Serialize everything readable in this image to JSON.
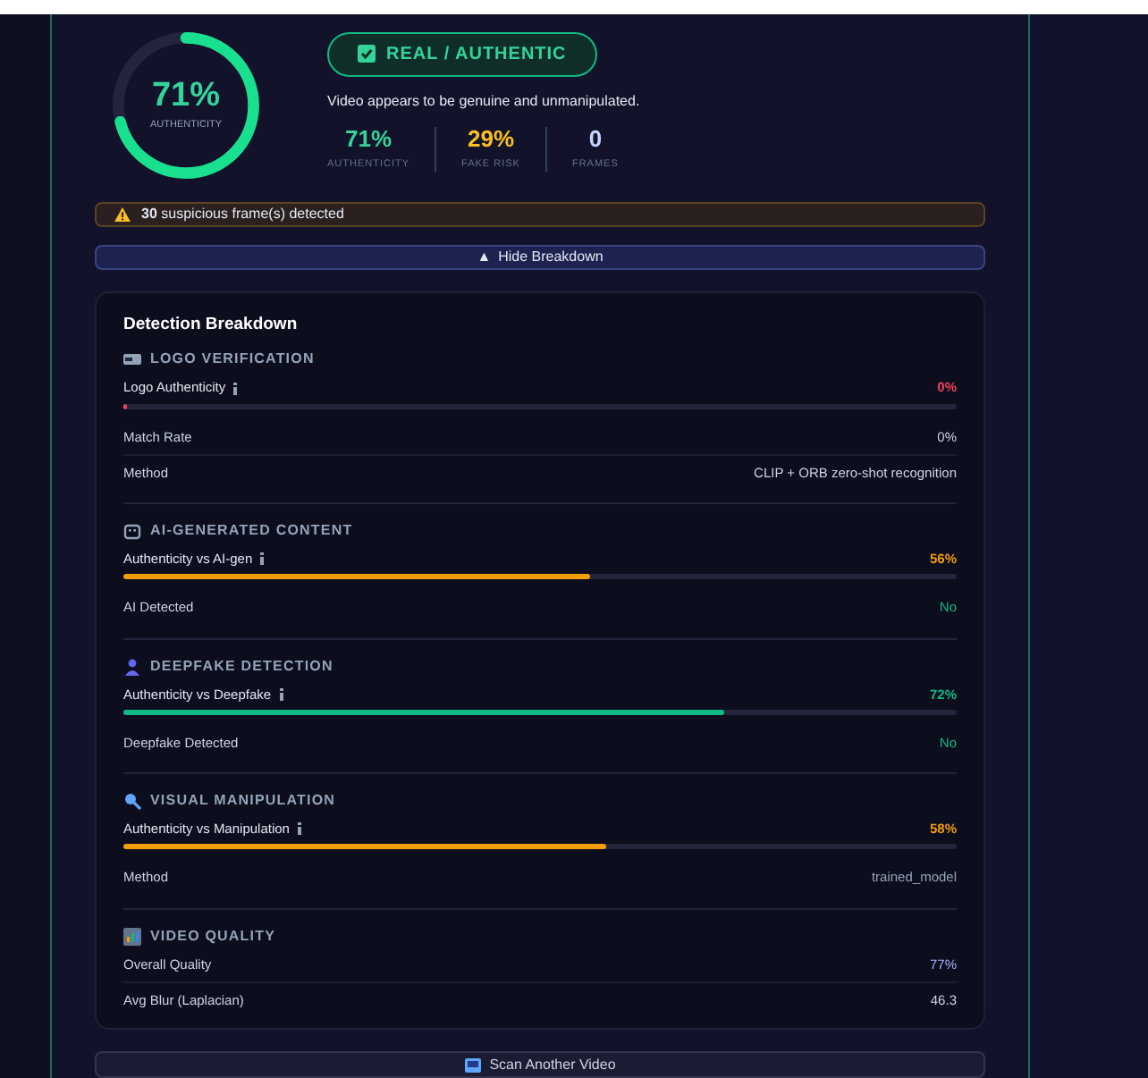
{
  "score": {
    "value": "71%",
    "label": "AUTHENTICITY"
  },
  "verdict": {
    "label": "REAL / AUTHENTIC",
    "kind": "real",
    "description": "Video appears to be genuine and unmanipulated."
  },
  "stats": [
    {
      "value": "71%",
      "label": "AUTHENTICITY",
      "color": "#34d399"
    },
    {
      "value": "29%",
      "label": "FAKE RISK",
      "color": "#fbbf24"
    },
    {
      "value": "0",
      "label": "FRAMES",
      "color": "#c7d2fe"
    }
  ],
  "warning": {
    "count": "30",
    "text": "suspicious frame(s) detected"
  },
  "toggle": {
    "arrow": "▲",
    "label": "Hide Breakdown",
    "expanded": true
  },
  "breakdown": {
    "title": "Detection Breakdown",
    "sections": [
      {
        "kind": "logo",
        "title": "LOGO VERIFICATION",
        "rows": [
          {
            "kind": "bar",
            "label": "Logo Authenticity",
            "value": "0%",
            "level": 0,
            "color": "#f43f5e"
          },
          {
            "kind": "row",
            "label": "Match Rate",
            "value": "0%",
            "color": "#cbd5e1"
          },
          {
            "kind": "row",
            "label": "Method",
            "value": "CLIP + ORB zero-shot recognition",
            "color": "#cbd5e1"
          }
        ]
      },
      {
        "kind": "ai",
        "title": "AI-GENERATED CONTENT",
        "rows": [
          {
            "kind": "bar",
            "label": "Authenticity vs AI-gen",
            "value": "56%",
            "level": 0.56,
            "color": "#f59e0b"
          },
          {
            "kind": "row",
            "label": "AI Detected",
            "value": "No",
            "color": "#10b981"
          }
        ]
      },
      {
        "kind": "deepfake",
        "title": "DEEPFAKE DETECTION",
        "rows": [
          {
            "kind": "bar",
            "label": "Authenticity vs Deepfake",
            "value": "72%",
            "level": 0.72,
            "color": "#10b981"
          },
          {
            "kind": "row",
            "label": "Deepfake Detected",
            "value": "No",
            "color": "#10b981"
          }
        ]
      },
      {
        "kind": "visual",
        "title": "VISUAL MANIPULATION",
        "rows": [
          {
            "kind": "bar",
            "label": "Authenticity vs Manipulation",
            "value": "58%",
            "level": 0.58,
            "color": "#f59e0b"
          },
          {
            "kind": "row",
            "label": "Method",
            "value": "trained_model",
            "color": "#94a3b8"
          }
        ]
      },
      {
        "kind": "quality",
        "title": "VIDEO QUALITY",
        "rows": [
          {
            "kind": "row",
            "label": "Overall Quality",
            "value": "77%",
            "color": "#a5b4fc"
          },
          {
            "kind": "row",
            "label": "Avg Blur (Laplacian)",
            "value": "46.3",
            "color": "#cbd5e1"
          }
        ]
      }
    ]
  },
  "scan_button": {
    "label": "Scan Another Video"
  }
}
